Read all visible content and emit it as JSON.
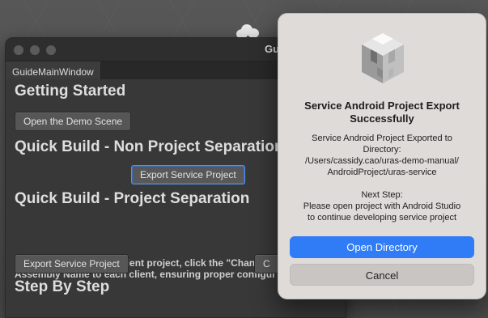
{
  "guide_window": {
    "title": "Gui",
    "tab_label": "GuideMainWindow",
    "sections": {
      "getting_started": "Getting Started",
      "quick_build_non_sep": "Quick Build - Non Project Separation",
      "quick_build_sep": "Quick Build - Project Separation",
      "step_by_step": "Step By Step"
    },
    "buttons": {
      "open_demo_scene": "Open the Demo Scene",
      "export_service_project_1": "Export Service Project",
      "export_service_project_2": "Export Service Project",
      "partial_button": "C"
    },
    "paragraph": {
      "line1": "Before exporting your client project, click the \"Change A",
      "line2": "Assembly Name to each client, ensuring proper configur"
    }
  },
  "dialog": {
    "icon": "unity-cube-icon",
    "title_line1": "Service Android Project Export",
    "title_line2": "Successfully",
    "message": {
      "line1": "Service Android Project Exported to",
      "line2": "Directory:",
      "line3": "/Users/cassidy.cao/uras-demo-manual/",
      "line4": "AndroidProject/uras-service",
      "line5": "Next Step:",
      "line6": "Please open project with Android Studio",
      "line7": "to continue developing service project"
    },
    "primary_button": "Open Directory",
    "secondary_button": "Cancel"
  },
  "colors": {
    "accent": "#2f7cf6",
    "window_bg": "#383838",
    "dialog_bg": "#dedbd9"
  }
}
